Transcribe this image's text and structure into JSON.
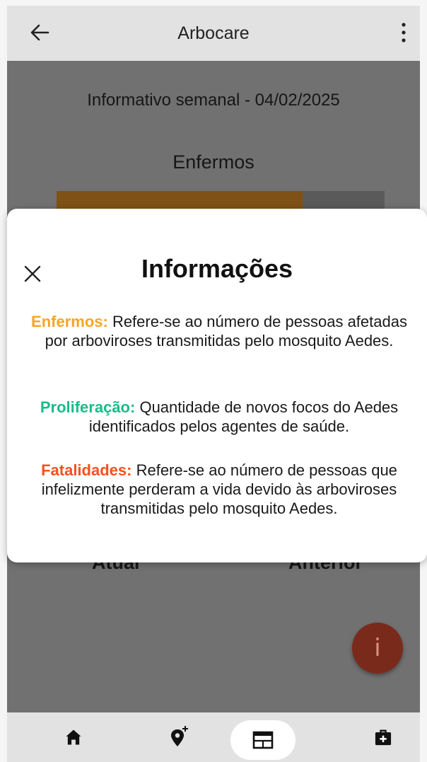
{
  "app": {
    "title": "Arbocare"
  },
  "header": {
    "weekly_title": "Informativo semanal - 04/02/2025",
    "section_title": "Enfermos"
  },
  "chart": {
    "fill_fraction": 0.75,
    "labels": [
      "Atual",
      "Anterior"
    ]
  },
  "fab": {
    "label": "i"
  },
  "modal": {
    "title": "Informações",
    "items": [
      {
        "term": "Enfermos:",
        "color": "#f5a623",
        "text": "Refere-se ao número de pessoas afetadas por arboviroses transmitidas pelo mosquito Aedes."
      },
      {
        "term": "Proliferação:",
        "color": "#1abc8c",
        "text": "Quantidade de novos focos do Aedes identificados pelos agentes de saúde."
      },
      {
        "term": "Fatalidades:",
        "color": "#f4511e",
        "text": "Refere-se ao número de pessoas que infelizmente perderam a vida devido às arboviroses transmitidas pelo mosquito Aedes."
      }
    ]
  },
  "nav": {
    "items": [
      "home-icon",
      "add-location-icon",
      "calendar-icon",
      "medical-kit-icon"
    ],
    "active": "calendar-icon"
  }
}
